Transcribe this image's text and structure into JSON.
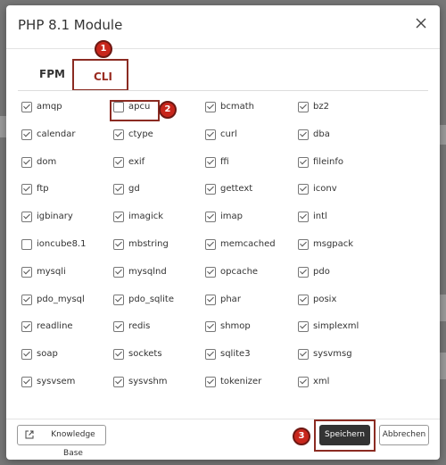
{
  "dialog": {
    "title": "PHP 8.1 Module",
    "close_icon": "close-icon"
  },
  "tabs": [
    {
      "label": "FPM",
      "selected": false
    },
    {
      "label": "CLI",
      "selected": true
    }
  ],
  "modules": [
    {
      "name": "amqp",
      "checked": true
    },
    {
      "name": "apcu",
      "checked": false
    },
    {
      "name": "bcmath",
      "checked": true
    },
    {
      "name": "bz2",
      "checked": true
    },
    {
      "name": "calendar",
      "checked": true
    },
    {
      "name": "ctype",
      "checked": true
    },
    {
      "name": "curl",
      "checked": true
    },
    {
      "name": "dba",
      "checked": true
    },
    {
      "name": "dom",
      "checked": true
    },
    {
      "name": "exif",
      "checked": true
    },
    {
      "name": "ffi",
      "checked": true
    },
    {
      "name": "fileinfo",
      "checked": true
    },
    {
      "name": "ftp",
      "checked": true
    },
    {
      "name": "gd",
      "checked": true
    },
    {
      "name": "gettext",
      "checked": true
    },
    {
      "name": "iconv",
      "checked": true
    },
    {
      "name": "igbinary",
      "checked": true
    },
    {
      "name": "imagick",
      "checked": true
    },
    {
      "name": "imap",
      "checked": true
    },
    {
      "name": "intl",
      "checked": true
    },
    {
      "name": "ioncube8.1",
      "checked": false
    },
    {
      "name": "mbstring",
      "checked": true
    },
    {
      "name": "memcached",
      "checked": true
    },
    {
      "name": "msgpack",
      "checked": true
    },
    {
      "name": "mysqli",
      "checked": true
    },
    {
      "name": "mysqlnd",
      "checked": true
    },
    {
      "name": "opcache",
      "checked": true
    },
    {
      "name": "pdo",
      "checked": true
    },
    {
      "name": "pdo_mysql",
      "checked": true
    },
    {
      "name": "pdo_sqlite",
      "checked": true
    },
    {
      "name": "phar",
      "checked": true
    },
    {
      "name": "posix",
      "checked": true
    },
    {
      "name": "readline",
      "checked": true
    },
    {
      "name": "redis",
      "checked": true
    },
    {
      "name": "shmop",
      "checked": true
    },
    {
      "name": "simplexml",
      "checked": true
    },
    {
      "name": "soap",
      "checked": true
    },
    {
      "name": "sockets",
      "checked": true
    },
    {
      "name": "sqlite3",
      "checked": true
    },
    {
      "name": "sysvmsg",
      "checked": true
    },
    {
      "name": "sysvsem",
      "checked": true
    },
    {
      "name": "sysvshm",
      "checked": true
    },
    {
      "name": "tokenizer",
      "checked": true
    },
    {
      "name": "xml",
      "checked": true
    }
  ],
  "annotations": {
    "step1": "1",
    "step2": "2",
    "step3": "3",
    "accent_color": "#c8261c"
  },
  "footer": {
    "knowledge_base_label": "Knowledge Base",
    "knowledge_base_icon": "external-link-icon",
    "save_label": "Speichern",
    "cancel_label": "Abbrechen"
  }
}
